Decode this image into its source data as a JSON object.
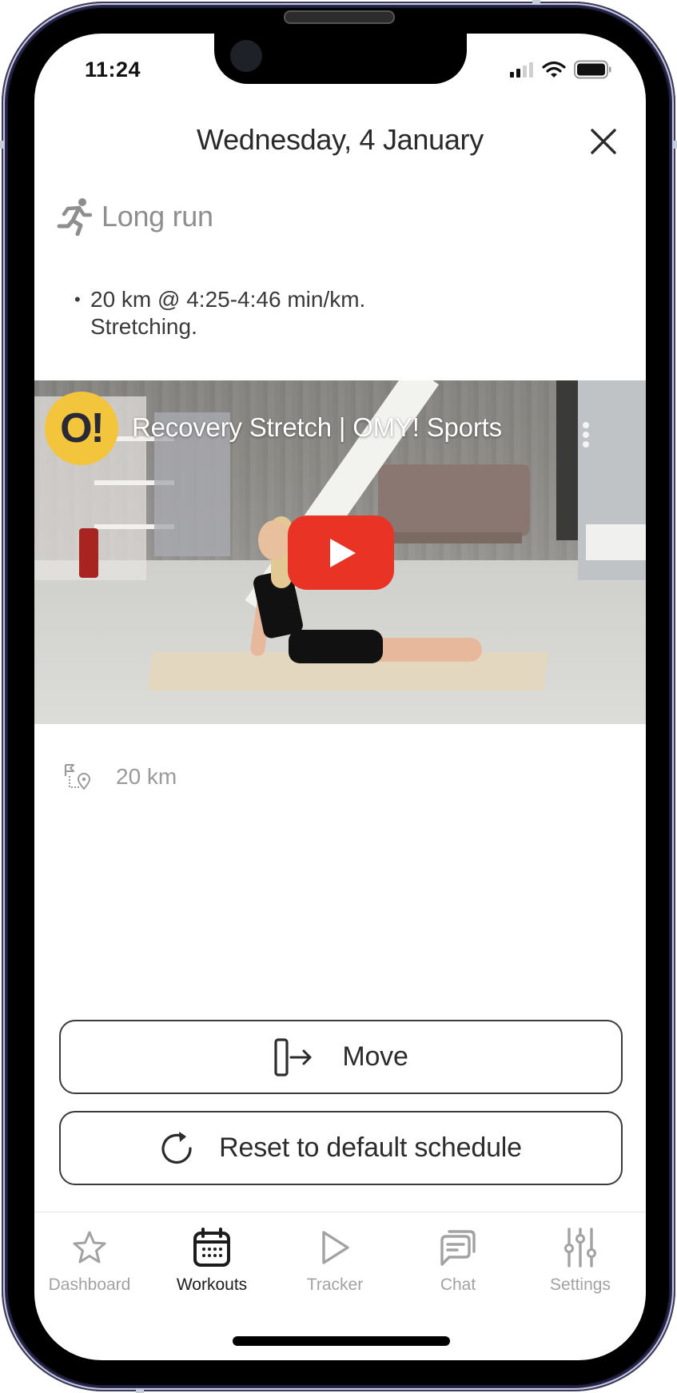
{
  "status_bar": {
    "time": "11:24",
    "signal_bars_filled": 2,
    "signal_bars_total": 4,
    "wifi_icon": "wifi-icon",
    "battery_icon": "battery-icon"
  },
  "header": {
    "title": "Wednesday, 4 January",
    "close_icon": "close-icon"
  },
  "workout": {
    "type_icon": "running-icon",
    "title": "Long run",
    "description_lines": [
      "20 km @ 4:25-4:46 min/km.",
      "Stretching."
    ],
    "bullet": "•"
  },
  "video": {
    "channel_logo_text": "O!",
    "title": "Recovery Stretch | OMY! Sports",
    "menu_icon": "more-vertical-icon",
    "play_icon": "youtube-play-icon",
    "colors": {
      "play_button": "#e93425",
      "channel_logo": "#f2c53d"
    }
  },
  "distance": {
    "icon": "route-icon",
    "value": "20 km"
  },
  "actions": {
    "move_label": "Move",
    "move_icon": "move-right-icon",
    "reset_label": "Reset to default schedule",
    "reset_icon": "refresh-icon"
  },
  "tabbar": {
    "active": "Workouts",
    "items": [
      {
        "label": "Dashboard",
        "icon": "star-icon"
      },
      {
        "label": "Workouts",
        "icon": "calendar-icon"
      },
      {
        "label": "Tracker",
        "icon": "play-icon"
      },
      {
        "label": "Chat",
        "icon": "chat-icon"
      },
      {
        "label": "Settings",
        "icon": "sliders-icon"
      }
    ]
  }
}
